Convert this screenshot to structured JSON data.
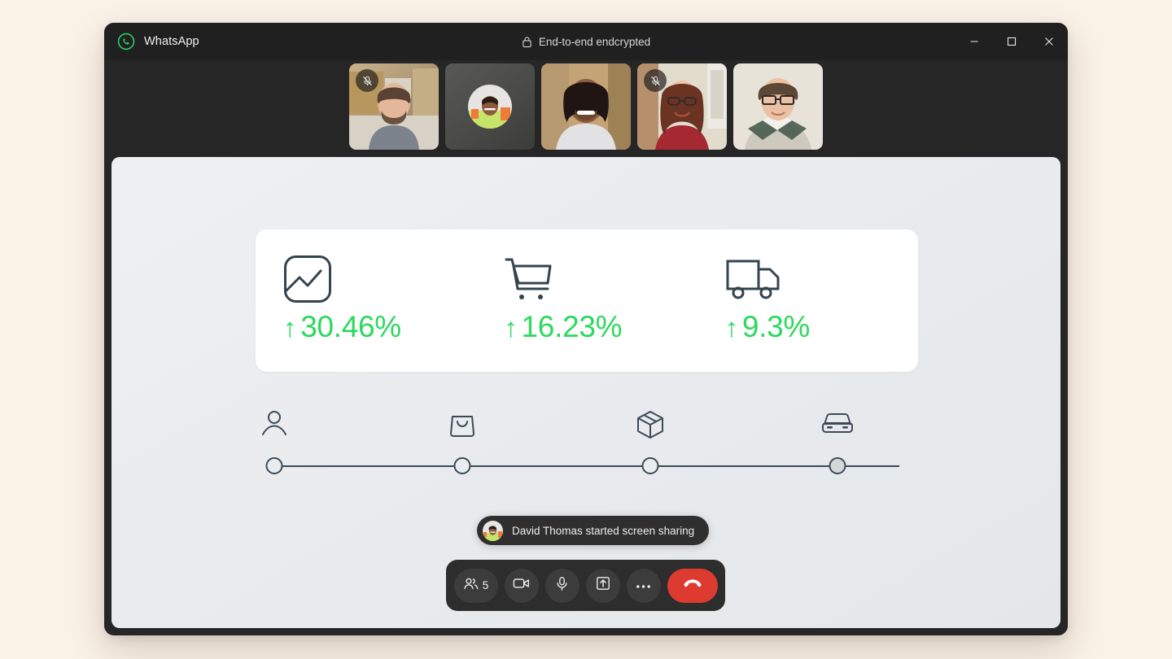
{
  "app": {
    "name": "WhatsApp",
    "logo_icon": "whatsapp-logo-icon",
    "encryption_label": "End-to-end endcrypted",
    "lock_icon": "lock-icon"
  },
  "window_controls": {
    "minimize": {
      "icon": "minimize-icon",
      "label": "–"
    },
    "maximize": {
      "icon": "maximize-icon",
      "label": "□"
    },
    "close": {
      "icon": "close-icon",
      "label": "✕"
    }
  },
  "participants": [
    {
      "id": "p1",
      "camera": "on",
      "muted": true,
      "mute_icon": "mic-off-icon"
    },
    {
      "id": "p2",
      "camera": "off",
      "muted": false,
      "avatar": "avatar-image"
    },
    {
      "id": "p3",
      "camera": "on",
      "muted": false
    },
    {
      "id": "p4",
      "camera": "on",
      "muted": true,
      "mute_icon": "mic-off-icon"
    },
    {
      "id": "p5",
      "camera": "on",
      "muted": false
    }
  ],
  "shared_screen": {
    "metrics": [
      {
        "icon": "analytics-trend-icon",
        "arrow": "↑",
        "value": "30.46%"
      },
      {
        "icon": "shopping-cart-icon",
        "arrow": "↑",
        "value": "16.23%"
      },
      {
        "icon": "delivery-truck-icon",
        "arrow": "↑",
        "value": "9.3%"
      }
    ],
    "metric_color": "#2bd95e",
    "timeline": {
      "steps": [
        {
          "icon": "person-icon",
          "position_pct": 0,
          "filled": false
        },
        {
          "icon": "shopping-bag-icon",
          "position_pct": 33.3,
          "filled": false
        },
        {
          "icon": "package-box-icon",
          "position_pct": 66.6,
          "filled": false
        },
        {
          "icon": "car-icon",
          "position_pct": 100,
          "filled": true
        }
      ]
    }
  },
  "toast": {
    "avatar_icon": "participant-avatar",
    "message": "David Thomas started screen sharing"
  },
  "controls": [
    {
      "name": "participants",
      "icon": "people-icon",
      "count": "5"
    },
    {
      "name": "camera",
      "icon": "video-camera-icon"
    },
    {
      "name": "microphone",
      "icon": "microphone-icon"
    },
    {
      "name": "share-screen",
      "icon": "share-screen-icon"
    },
    {
      "name": "more",
      "icon": "more-dots-icon"
    },
    {
      "name": "end-call",
      "icon": "end-call-icon",
      "color": "#de3b30"
    }
  ]
}
